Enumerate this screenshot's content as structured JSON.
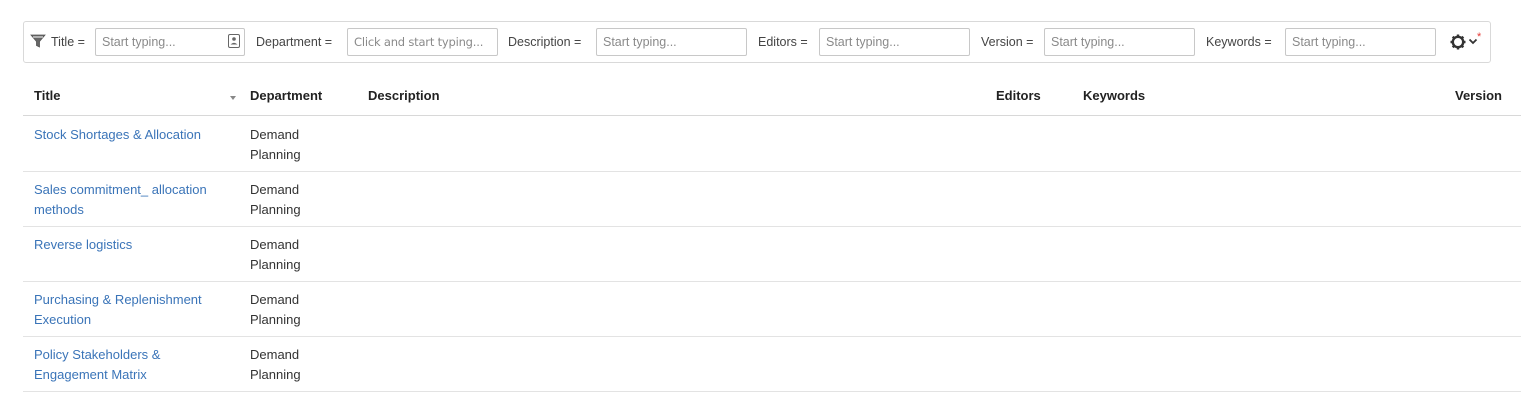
{
  "filters": {
    "title": {
      "label": "Title =",
      "placeholder": "Start typing..."
    },
    "department": {
      "label": "Department =",
      "placeholder": "Click and start typing..."
    },
    "description": {
      "label": "Description =",
      "placeholder": "Start typing..."
    },
    "editors": {
      "label": "Editors =",
      "placeholder": "Start typing..."
    },
    "version": {
      "label": "Version =",
      "placeholder": "Start typing..."
    },
    "keywords": {
      "label": "Keywords =",
      "placeholder": "Start typing..."
    },
    "icons": [
      "filter-icon",
      "contact-card-icon",
      "gear-icon",
      "chevron-down-icon"
    ],
    "indicator_color": "#e53935"
  },
  "table": {
    "columns": {
      "title": "Title",
      "department": "Department",
      "description": "Description",
      "editors": "Editors",
      "keywords": "Keywords",
      "version": "Version"
    },
    "sort": {
      "column": "title",
      "direction": "descending"
    },
    "link_color": "#3a74b8",
    "rows": [
      {
        "title": "Stock Shortages & Allocation",
        "department": "Demand Planning",
        "description": "",
        "editors": "",
        "keywords": "",
        "version": ""
      },
      {
        "title": "Sales commitment_ allocation methods",
        "department": "Demand Planning",
        "description": "",
        "editors": "",
        "keywords": "",
        "version": ""
      },
      {
        "title": "Reverse logistics",
        "department": "Demand Planning",
        "description": "",
        "editors": "",
        "keywords": "",
        "version": ""
      },
      {
        "title": "Purchasing & Replenishment Execution",
        "department": "Demand Planning",
        "description": "",
        "editors": "",
        "keywords": "",
        "version": ""
      },
      {
        "title": "Policy Stakeholders & Engagement Matrix",
        "department": "Demand Planning",
        "description": "",
        "editors": "",
        "keywords": "",
        "version": ""
      }
    ]
  }
}
